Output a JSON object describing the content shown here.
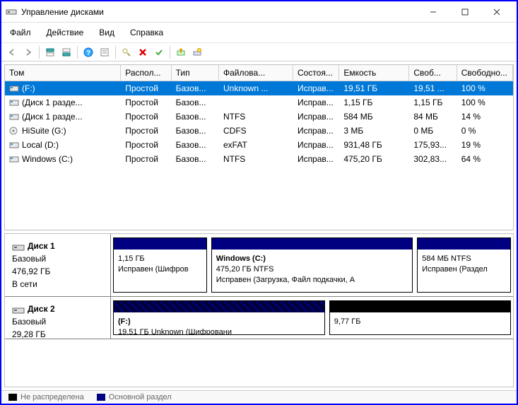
{
  "window": {
    "title": "Управление дисками"
  },
  "menu": {
    "file": "Файл",
    "action": "Действие",
    "view": "Вид",
    "help": "Справка"
  },
  "columns": {
    "tom": "Том",
    "raspol": "Распол...",
    "tip": "Тип",
    "fs": "Файлова...",
    "sost": "Состоя...",
    "emk": "Емкость",
    "svob": "Своб...",
    "pct": "Свободно..."
  },
  "volumes": [
    {
      "icon": "vol",
      "name": "(F:)",
      "raspol": "Простой",
      "tip": "Базов...",
      "fs": "Unknown ...",
      "sost": "Исправ...",
      "emk": "19,51 ГБ",
      "svob": "19,51 ...",
      "pct": "100 %",
      "selected": true
    },
    {
      "icon": "vol",
      "name": "(Диск 1 разде...",
      "raspol": "Простой",
      "tip": "Базов...",
      "fs": "",
      "sost": "Исправ...",
      "emk": "1,15 ГБ",
      "svob": "1,15 ГБ",
      "pct": "100 %"
    },
    {
      "icon": "vol",
      "name": "(Диск 1 разде...",
      "raspol": "Простой",
      "tip": "Базов...",
      "fs": "NTFS",
      "sost": "Исправ...",
      "emk": "584 МБ",
      "svob": "84 МБ",
      "pct": "14 %"
    },
    {
      "icon": "cd",
      "name": "HiSuite (G:)",
      "raspol": "Простой",
      "tip": "Базов...",
      "fs": "CDFS",
      "sost": "Исправ...",
      "emk": "3 МБ",
      "svob": "0 МБ",
      "pct": "0 %"
    },
    {
      "icon": "vol",
      "name": "Local (D:)",
      "raspol": "Простой",
      "tip": "Базов...",
      "fs": "exFAT",
      "sost": "Исправ...",
      "emk": "931,48 ГБ",
      "svob": "175,93...",
      "pct": "19 %"
    },
    {
      "icon": "vol",
      "name": "Windows (C:)",
      "raspol": "Простой",
      "tip": "Базов...",
      "fs": "NTFS",
      "sost": "Исправ...",
      "emk": "475,20 ГБ",
      "svob": "302,83...",
      "pct": "64 %"
    }
  ],
  "disks": [
    {
      "name": "Диск 1",
      "type": "Базовый",
      "size": "476,92 ГБ",
      "status": "В сети",
      "parts": [
        {
          "title": "",
          "line1": "1,15 ГБ",
          "line2": "Исправен (Шифров",
          "flex": 24,
          "header": "navy"
        },
        {
          "title": "Windows  (C:)",
          "line1": "475,20 ГБ NTFS",
          "line2": "Исправен (Загрузка, Файл подкачки, А",
          "flex": 52,
          "header": "navy"
        },
        {
          "title": "",
          "line1": "584 МБ NTFS",
          "line2": "Исправен (Раздел",
          "flex": 24,
          "header": "navy"
        }
      ]
    },
    {
      "name": "Диск 2",
      "type": "Базовый",
      "size": "29,28 ГБ",
      "status": "",
      "parts": [
        {
          "title": "(F:)",
          "line1": "19,51 ГБ Unknown (Шифровани",
          "line2": "",
          "flex": 35,
          "header": "striped"
        },
        {
          "title": "",
          "line1": "9,77 ГБ",
          "line2": "",
          "flex": 30,
          "header": "dark"
        }
      ]
    }
  ],
  "legend": {
    "unalloc": "Не распределена",
    "primary": "Основной раздел"
  }
}
